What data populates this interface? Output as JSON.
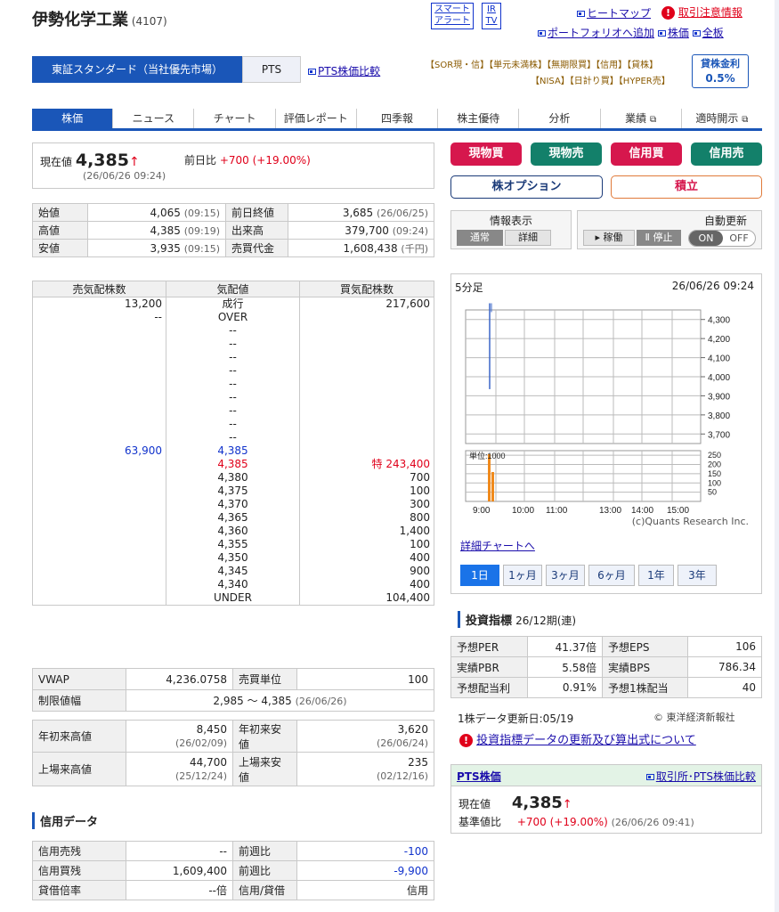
{
  "header": {
    "company": "伊勢化学工業",
    "code": "(4107)",
    "alert_smart": "スマート",
    "alert_alert": "アラート",
    "ir_line1": "IR",
    "ir_line2": "TV",
    "heatmap": "ヒートマップ",
    "caution": "取引注意情報",
    "portfolio": "ポートフォリオへ追加",
    "kabuka": "株価",
    "zenpan": "全板"
  },
  "market": {
    "tab1": "東証スタンダード（当社優先市場）",
    "tab2": "PTS",
    "pts_compare": "PTS株価比較",
    "tags1": "【SOR現・信】【単元未満株】【無期限買】【信用】【貸株】",
    "tags2": "【NISA】【日計り買】【HYPER売】",
    "lending_label": "貸株金利",
    "lending_value": "0.5%"
  },
  "tabs": [
    "株価",
    "ニュース",
    "チャート",
    "評価レポート",
    "四季報",
    "株主優待",
    "分析",
    "業績",
    "適時開示"
  ],
  "price": {
    "label": "現在値",
    "value": "4,385",
    "arrow": "↑",
    "change_label": "前日比",
    "change": "+700 (+19.00%)",
    "datetime": "(26/06/26 09:24)"
  },
  "quotes": [
    {
      "l1": "始値",
      "v1": "4,065",
      "t1": "(09:15)",
      "l2": "前日終値",
      "v2": "3,685",
      "t2": "(26/06/25)"
    },
    {
      "l1": "高値",
      "v1": "4,385",
      "t1": "(09:19)",
      "l2": "出来高",
      "v2": "379,700",
      "t2": "(09:24)"
    },
    {
      "l1": "安値",
      "v1": "3,935",
      "t1": "(09:15)",
      "l2": "売買代金",
      "v2": "1,608,438",
      "t2": "(千円)"
    }
  ],
  "orderbook": {
    "h1": "売気配株数",
    "h2": "気配値",
    "h3": "買気配株数",
    "rows": [
      [
        "13,200",
        "成行",
        "217,600"
      ],
      [
        "--",
        "OVER",
        ""
      ],
      [
        "",
        "--",
        ""
      ],
      [
        "",
        "--",
        ""
      ],
      [
        "",
        "--",
        ""
      ],
      [
        "",
        "--",
        ""
      ],
      [
        "",
        "--",
        ""
      ],
      [
        "",
        "--",
        ""
      ],
      [
        "",
        "--",
        ""
      ],
      [
        "",
        "--",
        ""
      ],
      [
        "",
        "--",
        ""
      ],
      [
        "63,900",
        "4,385",
        ""
      ],
      [
        "",
        "4,385",
        "特 243,400"
      ],
      [
        "",
        "4,380",
        "700"
      ],
      [
        "",
        "4,375",
        "100"
      ],
      [
        "",
        "4,370",
        "300"
      ],
      [
        "",
        "4,365",
        "800"
      ],
      [
        "",
        "4,360",
        "1,400"
      ],
      [
        "",
        "4,355",
        "100"
      ],
      [
        "",
        "4,350",
        "400"
      ],
      [
        "",
        "4,345",
        "900"
      ],
      [
        "",
        "4,340",
        "400"
      ],
      [
        "",
        "UNDER",
        "104,400"
      ]
    ]
  },
  "vwap": {
    "l1": "VWAP",
    "v1": "4,236.0758",
    "l2": "売買単位",
    "v2": "100",
    "l3": "制限値幅",
    "v3": "2,985 ～ 4,385",
    "t3": "(26/06/26)"
  },
  "highs": [
    {
      "l1": "年初来高値",
      "v1": "8,450",
      "d1": "(26/02/09)",
      "l2": "年初来安値",
      "v2": "3,620",
      "d2": "(26/06/24)"
    },
    {
      "l1": "上場来高値",
      "v1": "44,700",
      "d1": "(25/12/24)",
      "l2": "上場来安値",
      "v2": "235",
      "d2": "(02/12/16)"
    }
  ],
  "credit": {
    "title": "信用データ",
    "rows": [
      {
        "l1": "信用売残",
        "v1": "--",
        "l2": "前週比",
        "v2": "-100"
      },
      {
        "l1": "信用買残",
        "v1": "1,609,400",
        "l2": "前週比",
        "v2": "-9,900"
      },
      {
        "l1": "貸借倍率",
        "v1": "--倍",
        "l2": "信用/貸借",
        "v2": "信用"
      }
    ]
  },
  "actions": {
    "buy": "現物買",
    "sell": "現物売",
    "mbuy": "信用買",
    "msell": "信用売",
    "option": "株オプション",
    "tsumitate": "積立"
  },
  "display": {
    "label": "情報表示",
    "normal": "通常",
    "detail": "詳細",
    "auto_label": "自動更新",
    "run": "稼働",
    "stop": "停止",
    "on": "ON",
    "off": "OFF"
  },
  "chart": {
    "title": "5分足",
    "datetime": "26/06/26 09:24",
    "vol_label": "単位:1000",
    "credit": "(c)Quants Research Inc.",
    "detail_link": "詳細チャートへ",
    "periods": [
      "1日",
      "1ヶ月",
      "3ヶ月",
      "6ヶ月",
      "1年",
      "3年"
    ]
  },
  "chart_data": {
    "type": "line",
    "title": "5分足",
    "price_ticks": [
      4300,
      4200,
      4100,
      4000,
      3900,
      3800,
      3700
    ],
    "volume_ticks": [
      250,
      200,
      150,
      100,
      50
    ],
    "x_ticks": [
      "9:00",
      "10:00",
      "11:00",
      "13:00",
      "14:00",
      "15:00"
    ],
    "volume_unit": "単位:1000",
    "price": {
      "open": 4065,
      "high": 4385,
      "low": 3935,
      "close": 4385
    }
  },
  "indicators": {
    "title": "投資指標",
    "period": "26/12期(連)",
    "rows": [
      {
        "l1": "予想PER",
        "v1": "41.37倍",
        "l2": "予想EPS",
        "v2": "106"
      },
      {
        "l1": "実績PBR",
        "v1": "5.58倍",
        "l2": "実績BPS",
        "v2": "786.34"
      },
      {
        "l1": "予想配当利",
        "v1": "0.91%",
        "l2": "予想1株配当",
        "v2": "40"
      }
    ],
    "update": "1株データ更新日:05/19",
    "source": "© 東洋経済新報社",
    "note": "投資指標データの更新及び算出式について"
  },
  "pts": {
    "title": "PTS株価",
    "link": "取引所･PTS株価比較",
    "price_label": "現在値",
    "price": "4,385",
    "arrow": "↑",
    "base_label": "基準値比",
    "change": "+700 (+19.00%)",
    "datetime": "(26/06/26 09:41)"
  }
}
